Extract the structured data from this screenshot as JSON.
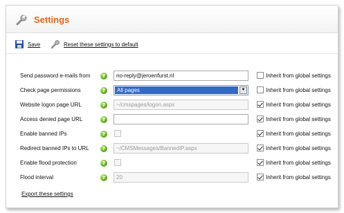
{
  "header": {
    "title": "Settings",
    "icon": "wrench-icon"
  },
  "toolbar": {
    "save_label": "Save",
    "reset_label": "Reset these settings to default"
  },
  "rows": [
    {
      "label": "Send password e-mails from",
      "type": "text",
      "value": "no-reply@jeroenfurst.nl",
      "disabled": false,
      "inherit_checked": false
    },
    {
      "label": "Check page permissions",
      "type": "select",
      "value": "All pages",
      "disabled": false,
      "inherit_checked": false
    },
    {
      "label": "Website logon page URL",
      "type": "text",
      "value": "~/cmspages/logon.aspx",
      "disabled": true,
      "inherit_checked": true
    },
    {
      "label": "Access denied page URL",
      "type": "text",
      "value": "",
      "disabled": false,
      "inherit_checked": true
    },
    {
      "label": "Enable banned IPs",
      "type": "checkbox",
      "value": "",
      "disabled": true,
      "inherit_checked": true
    },
    {
      "label": "Redirect banned IPs to URL",
      "type": "text",
      "value": "~/CMSMessages/BannedIP.aspx",
      "disabled": true,
      "inherit_checked": true
    },
    {
      "label": "Enable flood protection",
      "type": "checkbox",
      "value": "",
      "disabled": true,
      "inherit_checked": true
    },
    {
      "label": "Flood interval",
      "type": "text",
      "value": "20",
      "disabled": true,
      "inherit_checked": true
    }
  ],
  "inherit_label": "Inherit from global settings",
  "help_glyph": "?",
  "select_arrow": "▼",
  "footer": {
    "export_label": "Export these settings"
  },
  "colors": {
    "title": "#e8641b",
    "selection": "#3169c6",
    "help": "#55a51a"
  }
}
